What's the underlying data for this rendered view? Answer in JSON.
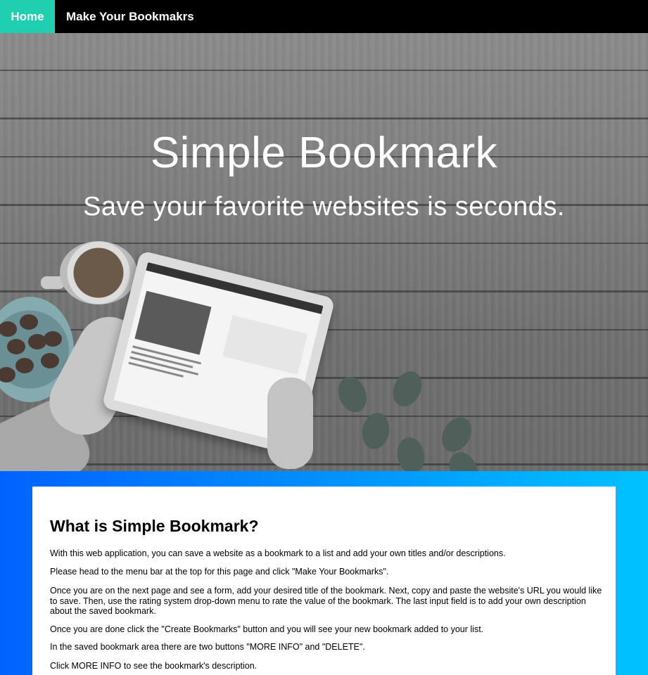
{
  "nav": {
    "home_label": "Home",
    "bookmarks_label": "Make Your Bookmakrs"
  },
  "hero": {
    "title": "Simple Bookmark",
    "subtitle": "Save your favorite websites is seconds."
  },
  "info": {
    "heading": "What is Simple Bookmark?",
    "paragraphs": [
      "With this web application, you can save a website as a bookmark to a list and add your own titles and/or descriptions.",
      "Please head to the menu bar at the top for this page and click \"Make Your Bookmarks\".",
      "Once you are on the next page and see a form, add your desired title of the bookmark. Next, copy and paste the website's URL you would like to save. Then, use the rating system drop-down menu to rate the value of the bookmark. The last input field is to add your own description about the saved bookmark.",
      "Once you are done click the \"Create Bookmarks\" button and you will see your new bookmark added to your list.",
      "In the saved bookmark area there are two buttons \"MORE INFO\" and \"DELETE\".",
      "Click MORE INFO to see the bookmark's description."
    ]
  },
  "colors": {
    "home_accent": "#1fd0b0",
    "nav_bg": "#000000",
    "band_gradient_start": "#0063ff",
    "band_gradient_end": "#00c2ff"
  }
}
